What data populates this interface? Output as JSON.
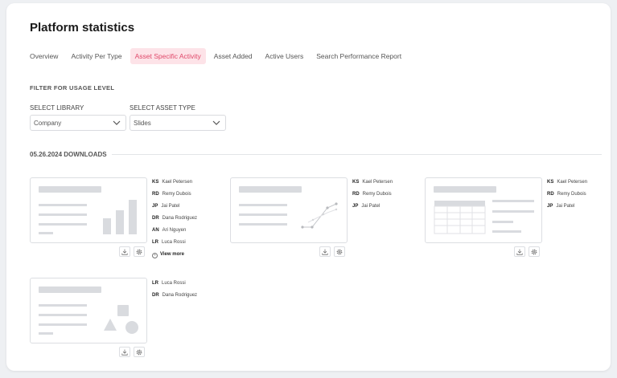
{
  "page_title": "Platform statistics",
  "tabs": [
    {
      "label": "Overview"
    },
    {
      "label": "Activity Per Type"
    },
    {
      "label": "Asset Specific Activity"
    },
    {
      "label": "Asset Added"
    },
    {
      "label": "Active Users"
    },
    {
      "label": "Search Performance Report"
    }
  ],
  "active_tab": "Asset Specific Activity",
  "filter": {
    "title": "FILTER FOR USAGE LEVEL",
    "library": {
      "label": "SELECT LIBRARY",
      "value": "Company"
    },
    "asset_type": {
      "label": "SELECT ASSET TYPE",
      "value": "Slides"
    }
  },
  "downloads": {
    "heading": "05.26.2024 DOWNLOADS",
    "assets": [
      {
        "thumbnail": "bar-chart",
        "users": [
          {
            "initials": "KS",
            "name": "Kael Petersen"
          },
          {
            "initials": "RD",
            "name": "Remy Dubois"
          },
          {
            "initials": "JP",
            "name": "Jai Patel"
          },
          {
            "initials": "DR",
            "name": "Dana Rodriguez"
          },
          {
            "initials": "AN",
            "name": "Ari Nguyen"
          },
          {
            "initials": "LR",
            "name": "Luca Rossi"
          }
        ],
        "view_more": "View more"
      },
      {
        "thumbnail": "line-chart",
        "users": [
          {
            "initials": "KS",
            "name": "Kael Petersen"
          },
          {
            "initials": "RD",
            "name": "Remy Dubois"
          },
          {
            "initials": "JP",
            "name": "Jai Patel"
          }
        ]
      },
      {
        "thumbnail": "table",
        "users": [
          {
            "initials": "KS",
            "name": "Kael Petersen"
          },
          {
            "initials": "RD",
            "name": "Remy Dubois"
          },
          {
            "initials": "JP",
            "name": "Jai Patel"
          }
        ]
      },
      {
        "thumbnail": "shapes",
        "users": [
          {
            "initials": "LR",
            "name": "Luca Rossi"
          },
          {
            "initials": "DR",
            "name": "Dana Rodriguez"
          }
        ]
      }
    ]
  },
  "icons": {
    "download": "download-icon",
    "settings": "gear-icon",
    "dropdown": "chevron-down-icon",
    "view_more": "plus-circle-icon"
  },
  "colors": {
    "accent": "#e0496a",
    "accent_bg": "#fde3e8",
    "placeholder": "#d9dbdf"
  }
}
